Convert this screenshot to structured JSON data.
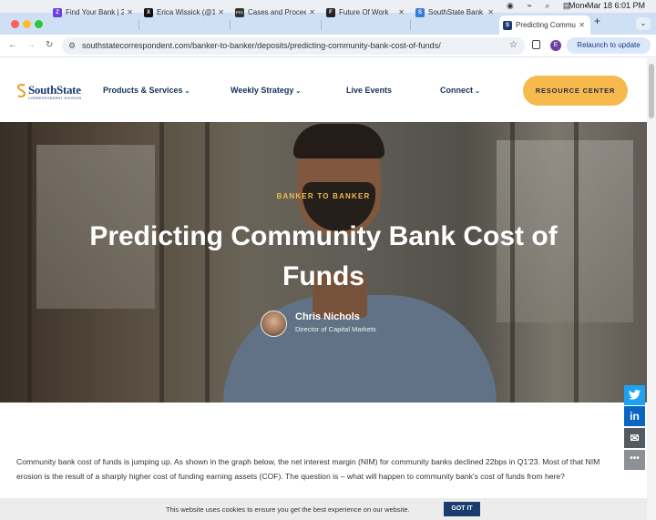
{
  "menubar": {
    "clock": "Mon Mar 18  6:01 PM"
  },
  "tabs": [
    {
      "title": "Find Your Bank | 2",
      "icon": "Z",
      "color": "#6b3fe0"
    },
    {
      "title": "Erica Wissick (@1",
      "icon": "X",
      "color": "#111111"
    },
    {
      "title": "Cases and Procee",
      "icon": "FTC",
      "color": "#333333"
    },
    {
      "title": "Future Of Work",
      "icon": "F",
      "color": "#222222"
    },
    {
      "title": "SouthState Bank |",
      "icon": "S",
      "color": "#3a7bd5"
    },
    {
      "title": "Predicting Commu",
      "icon": "S",
      "color": "#1c3d6e"
    }
  ],
  "browser": {
    "url": "southstatecorrespondent.com/banker-to-banker/deposits/predicting-community-bank-cost-of-funds/",
    "profile_initial": "E",
    "relaunch": "Relaunch to update"
  },
  "site": {
    "logo": "SouthState",
    "logo_sub": "CORRESPONDENT DIVISION",
    "menu": {
      "products": "Products & Services",
      "strategy": "Weekly Strategy",
      "events": "Live Events",
      "connect": "Connect"
    },
    "resource_button": "RESOURCE CENTER"
  },
  "hero": {
    "kicker": "BANKER TO BANKER",
    "title": "Predicting Community Bank Cost of Funds",
    "author_name": "Chris Nichols",
    "author_role": "Director of Capital Markets"
  },
  "article": {
    "intro": "Community bank cost of funds is jumping up. As shown in the graph below, the net interest margin (NIM) for community banks declined 22bps in Q1'23.  Most of that NIM erosion is the result of a sharply higher cost of funding earning assets (COF). The question is – what will happen to community bank's cost of funds from here?"
  },
  "cookie": {
    "message": "This website uses cookies to ensure you get the best experience on our website.",
    "button": "GOT IT"
  }
}
